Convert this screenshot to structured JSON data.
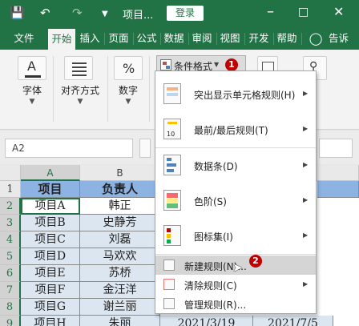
{
  "titlebar": {
    "title": "项目...",
    "login": "登录"
  },
  "tabs": [
    "文件",
    "开始",
    "插入",
    "页面",
    "公式",
    "数据",
    "审阅",
    "视图",
    "开发",
    "帮助",
    "告诉"
  ],
  "ribbon": {
    "groups": [
      {
        "label": "字体",
        "icon": "font-icon"
      },
      {
        "label": "对齐方式",
        "icon": "align-icon"
      },
      {
        "label": "数字",
        "icon": "percent-icon"
      }
    ],
    "conditional_format": "条件格式"
  },
  "formula_bar": {
    "name_box": "A2"
  },
  "grid": {
    "columns": [
      "A",
      "B"
    ],
    "rows": [
      "1",
      "2",
      "3",
      "4",
      "5",
      "6",
      "7",
      "8",
      "9"
    ],
    "header_row": [
      "项目",
      "负责人"
    ],
    "data": [
      [
        "项目A",
        "韩正"
      ],
      [
        "项目B",
        "史静芳"
      ],
      [
        "项目C",
        "刘磊"
      ],
      [
        "项目D",
        "马欢欢"
      ],
      [
        "项目E",
        "苏桥"
      ],
      [
        "项目F",
        "金汪洋"
      ],
      [
        "项目G",
        "谢兰丽"
      ],
      [
        "项目H",
        "朱丽"
      ]
    ],
    "last_row_extra": [
      "2021/3/19",
      "2021/7/5"
    ]
  },
  "menu": {
    "items": [
      {
        "label": "突出显示单元格规则(H)",
        "icon": "highlight-rules-icon"
      },
      {
        "label": "最前/最后规则(T)",
        "icon": "top-bottom-rules-icon"
      },
      {
        "label": "数据条(D)",
        "icon": "data-bars-icon"
      },
      {
        "label": "色阶(S)",
        "icon": "color-scales-icon"
      },
      {
        "label": "图标集(I)",
        "icon": "icon-sets-icon"
      },
      {
        "label": "新建规则(N)...",
        "icon": "new-rule-icon"
      },
      {
        "label": "清除规则(C)",
        "icon": "clear-rules-icon"
      },
      {
        "label": "管理规则(R)...",
        "icon": "manage-rules-icon"
      }
    ]
  },
  "badges": [
    "1",
    "2"
  ],
  "colors": {
    "accent": "#217346",
    "header_fill": "#8db3e2",
    "band_fill": "#dce6f1",
    "badge": "#c00000"
  }
}
